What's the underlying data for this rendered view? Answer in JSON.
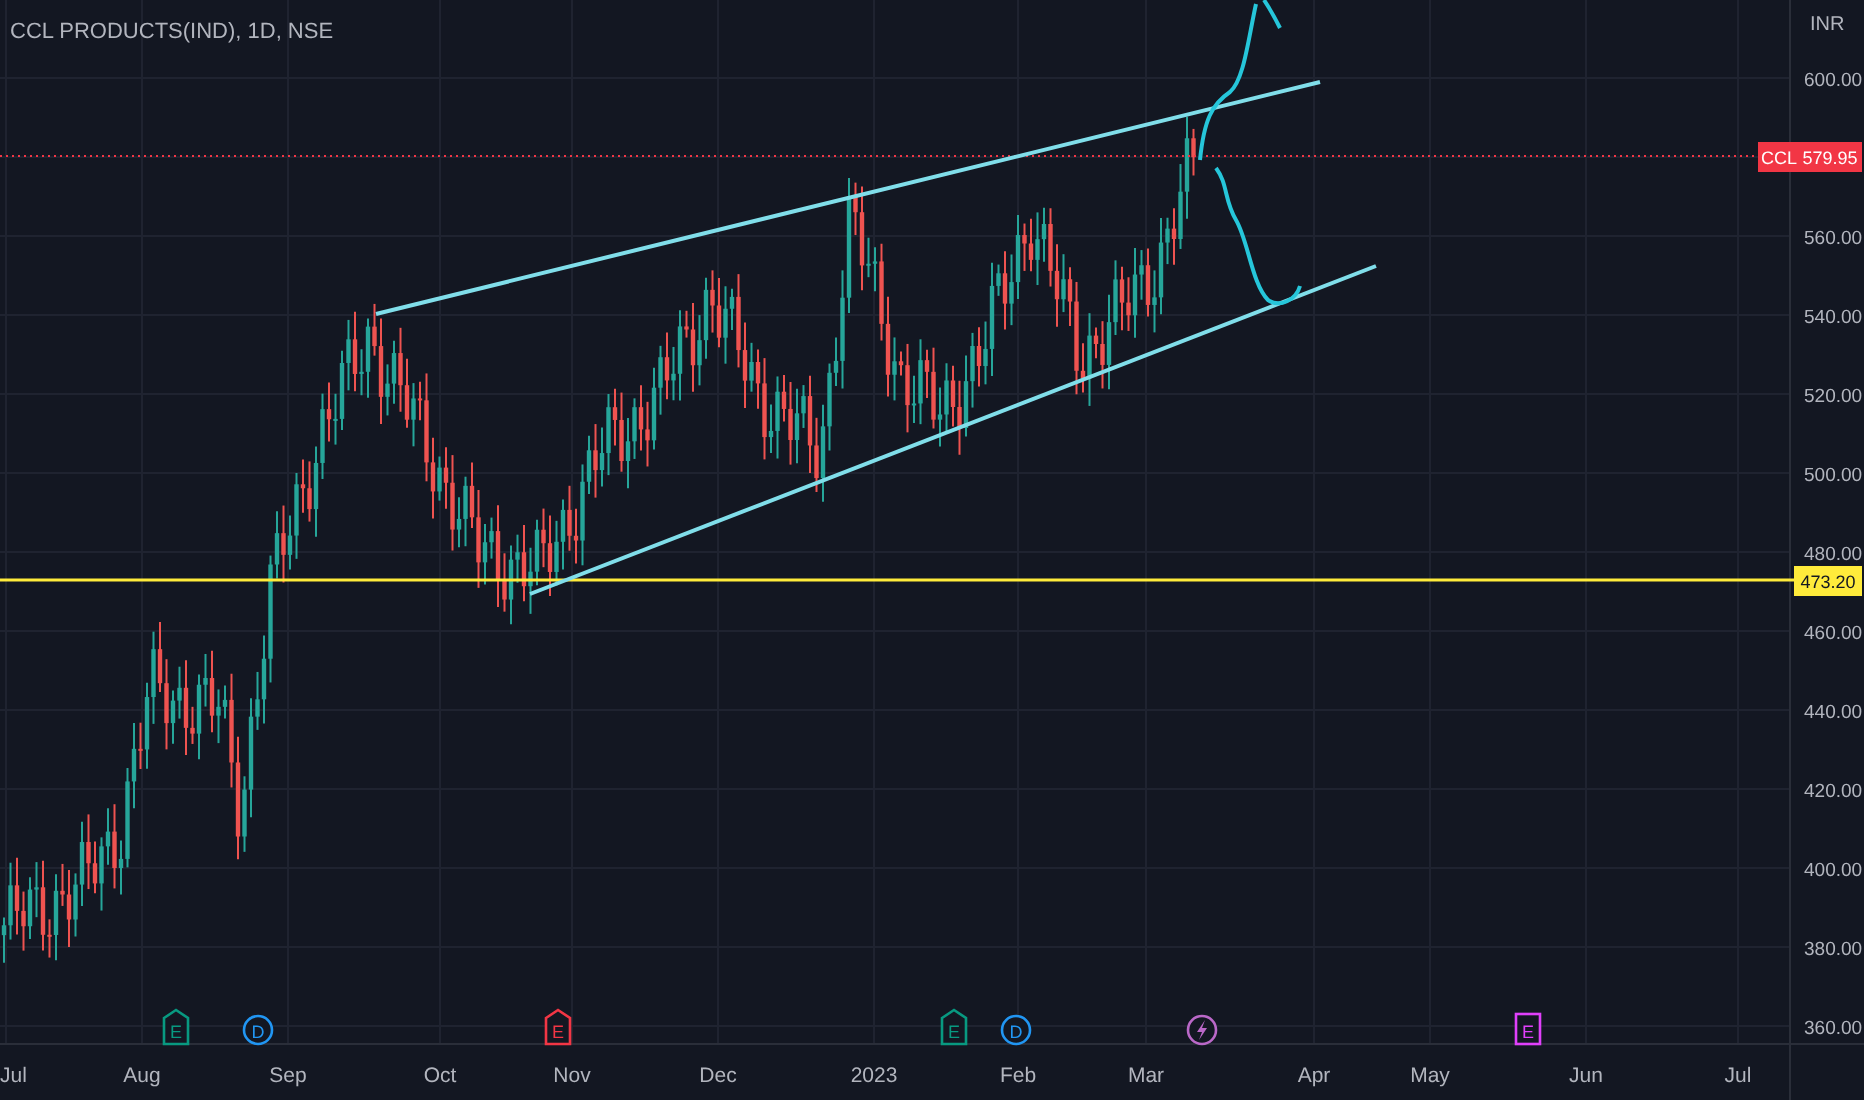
{
  "header": {
    "title": "CCL PRODUCTS(IND), 1D, NSE"
  },
  "price_axis": {
    "currency": "INR",
    "ticks": [
      "600.00",
      "560.00",
      "540.00",
      "520.00",
      "500.00",
      "480.00",
      "460.00",
      "440.00",
      "420.00",
      "400.00",
      "380.00",
      "360.00"
    ]
  },
  "last_price": {
    "symbol": "CCL",
    "value": "579.95"
  },
  "horizontal_line": {
    "value": "473.20"
  },
  "time_axis": {
    "labels": [
      "Jul",
      "Aug",
      "Sep",
      "Oct",
      "Nov",
      "Dec",
      "2023",
      "Feb",
      "Mar",
      "Apr",
      "May",
      "Jun",
      "Jul"
    ]
  },
  "events": [
    {
      "kind": "earnings",
      "text": "E",
      "color": "#089981"
    },
    {
      "kind": "dividend",
      "text": "D",
      "color": "#2196f3"
    },
    {
      "kind": "earnings",
      "text": "E",
      "color": "#f23645"
    },
    {
      "kind": "earnings",
      "text": "E",
      "color": "#089981"
    },
    {
      "kind": "dividend",
      "text": "D",
      "color": "#2196f3"
    },
    {
      "kind": "news",
      "color": "#ba68c8"
    },
    {
      "kind": "upcoming",
      "text": "E",
      "color": "#e040fb"
    }
  ]
}
